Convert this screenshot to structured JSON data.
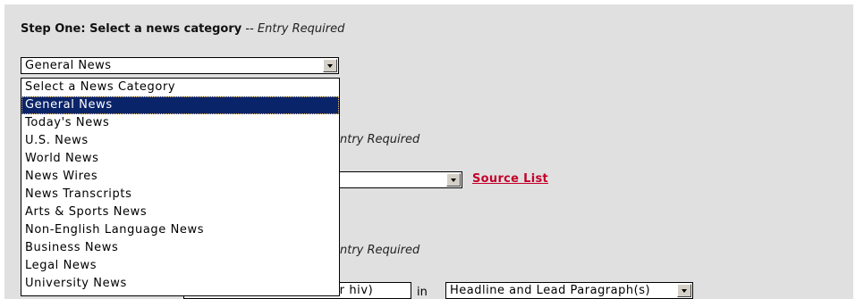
{
  "step_one": {
    "title": "Step One: Select a news category",
    "separator": " -- ",
    "required": "Entry Required",
    "selected": "General News",
    "options": [
      "Select a News Category",
      "General News",
      "Today's News",
      "U.S. News",
      "World News",
      "News Wires",
      "News Transcripts",
      "Arts & Sports News",
      "Non-English Language News",
      "Business News",
      "Legal News",
      "University News"
    ],
    "highlighted_index": 1
  },
  "step_two": {
    "required_partial": "ntry Required",
    "source_link": "Source List"
  },
  "step_three": {
    "required_partial": "ntry Required",
    "term_partial": "s or hiv)",
    "in_label": "in",
    "field_selected": "Headline and Lead Paragraph(s)"
  }
}
